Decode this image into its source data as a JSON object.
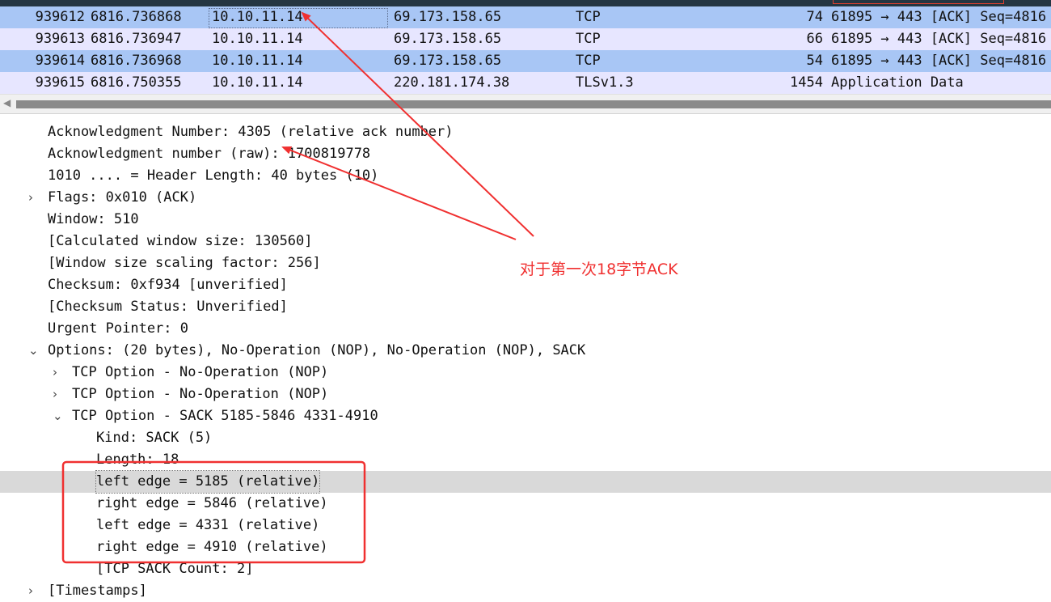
{
  "packets": [
    {
      "no": "939612",
      "time": "6816.736868",
      "src": "10.10.11.14",
      "dst": "69.173.158.65",
      "proto": "TCP",
      "len": "74",
      "info": "61895 → 443 [ACK] Seq=4816"
    },
    {
      "no": "939613",
      "time": "6816.736947",
      "src": "10.10.11.14",
      "dst": "69.173.158.65",
      "proto": "TCP",
      "len": "66",
      "info": "61895 → 443 [ACK] Seq=4816"
    },
    {
      "no": "939614",
      "time": "6816.736968",
      "src": "10.10.11.14",
      "dst": "69.173.158.65",
      "proto": "TCP",
      "len": "54",
      "info": "61895 → 443 [ACK] Seq=4816"
    },
    {
      "no": "939615",
      "time": "6816.750355",
      "src": "10.10.11.14",
      "dst": "220.181.174.38",
      "proto": "TLSv1.3",
      "len": "1454",
      "info": "Application Data"
    }
  ],
  "detail": [
    {
      "text": "Acknowledgment Number: 4305    (relative ack number)",
      "expander": ""
    },
    {
      "text": "Acknowledgment number (raw): 1700819778",
      "expander": ""
    },
    {
      "text": "1010 .... = Header Length: 40 bytes (10)",
      "expander": ""
    },
    {
      "text": "Flags: 0x010 (ACK)",
      "expander": "›"
    },
    {
      "text": "Window: 510",
      "expander": ""
    },
    {
      "text": "[Calculated window size: 130560]",
      "expander": ""
    },
    {
      "text": "[Window size scaling factor: 256]",
      "expander": ""
    },
    {
      "text": "Checksum: 0xf934 [unverified]",
      "expander": ""
    },
    {
      "text": "[Checksum Status: Unverified]",
      "expander": ""
    },
    {
      "text": "Urgent Pointer: 0",
      "expander": ""
    },
    {
      "text": "Options: (20 bytes), No-Operation (NOP), No-Operation (NOP), SACK",
      "expander": "⌄"
    },
    {
      "text": "TCP Option - No-Operation (NOP)",
      "expander": "›"
    },
    {
      "text": "TCP Option - No-Operation (NOP)",
      "expander": "›"
    },
    {
      "text": "TCP Option - SACK 5185-5846 4331-4910",
      "expander": "⌄"
    },
    {
      "text": "Kind: SACK (5)",
      "expander": ""
    },
    {
      "text": "Length: 18",
      "expander": ""
    },
    {
      "text": "left edge = 5185 (relative)",
      "expander": ""
    },
    {
      "text": "right edge = 5846 (relative)",
      "expander": ""
    },
    {
      "text": "left edge = 4331 (relative)",
      "expander": ""
    },
    {
      "text": "right edge = 4910 (relative)",
      "expander": ""
    },
    {
      "text": "[TCP SACK Count: 2]",
      "expander": ""
    },
    {
      "text": "[Timestamps]",
      "expander": "›"
    }
  ],
  "annotation": {
    "text": "对于第一次18字节ACK",
    "color": "#f03030"
  },
  "colors": {
    "packet_row_tcp_selected": "#a8c6f5",
    "packet_row_tcp": "#e7e6ff",
    "highlight": "#d9d9d9",
    "accent_red": "#f03030"
  }
}
